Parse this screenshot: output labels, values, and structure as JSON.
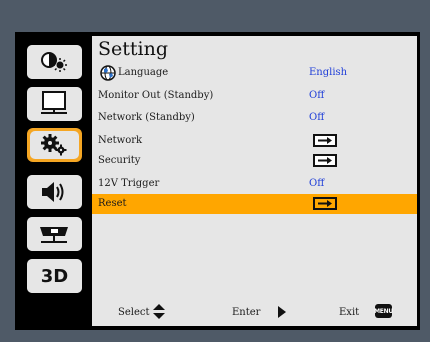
{
  "menu": {
    "title": "Setting",
    "items": [
      {
        "label": "Language",
        "value": "English"
      },
      {
        "label": "Monitor Out (Standby)",
        "value": "Off"
      },
      {
        "label": "Network (Standby)",
        "value": "Off"
      },
      {
        "label": "Network"
      },
      {
        "label": "Security"
      },
      {
        "label": "12V Trigger",
        "value": "Off"
      },
      {
        "label": "Reset"
      }
    ]
  },
  "sidebar": [
    {
      "icon": "picture-icon"
    },
    {
      "icon": "screen-icon"
    },
    {
      "icon": "settings-icon"
    },
    {
      "icon": "audio-icon"
    },
    {
      "icon": "projector-icon"
    },
    {
      "icon": "3d-icon",
      "label": "3D"
    }
  ],
  "footer": {
    "select": "Select",
    "enter": "Enter",
    "exit": "Exit",
    "menu_key": "MENU"
  },
  "colors": {
    "accent": "#FFA600",
    "value_text": "#1F3ED8"
  }
}
